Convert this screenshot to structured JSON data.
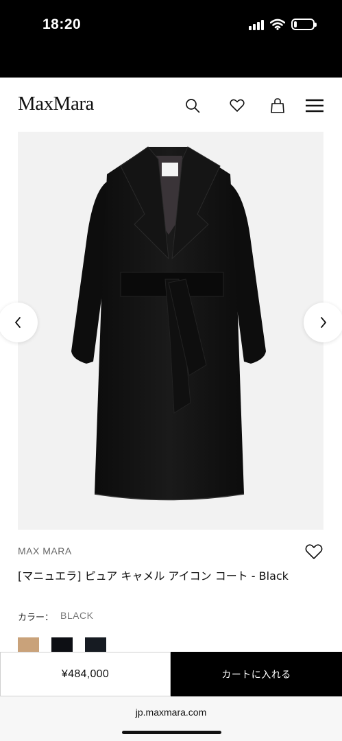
{
  "status_bar": {
    "time": "18:20",
    "battery_level": 0.15
  },
  "header": {
    "logo": "MaxMara",
    "icons": [
      "search-icon",
      "heart-icon",
      "bag-icon",
      "menu-icon"
    ]
  },
  "product": {
    "image_alt": "black belted wrap coat",
    "brand": "MAX MARA",
    "title": "[マニュエラ] ピュア キャメル アイコン コート - Black",
    "color_label": "カラー：",
    "color_value": "BLACK",
    "swatches": [
      {
        "color": "#c9a27a"
      },
      {
        "color": "#0d0f14"
      },
      {
        "color": "#161b22"
      }
    ]
  },
  "buy_bar": {
    "price": "¥484,000",
    "cart_label": "カートに入れる"
  },
  "browser": {
    "url": "jp.maxmara.com"
  },
  "colors": {
    "accent": "#000000",
    "background": "#f2f2f2"
  }
}
